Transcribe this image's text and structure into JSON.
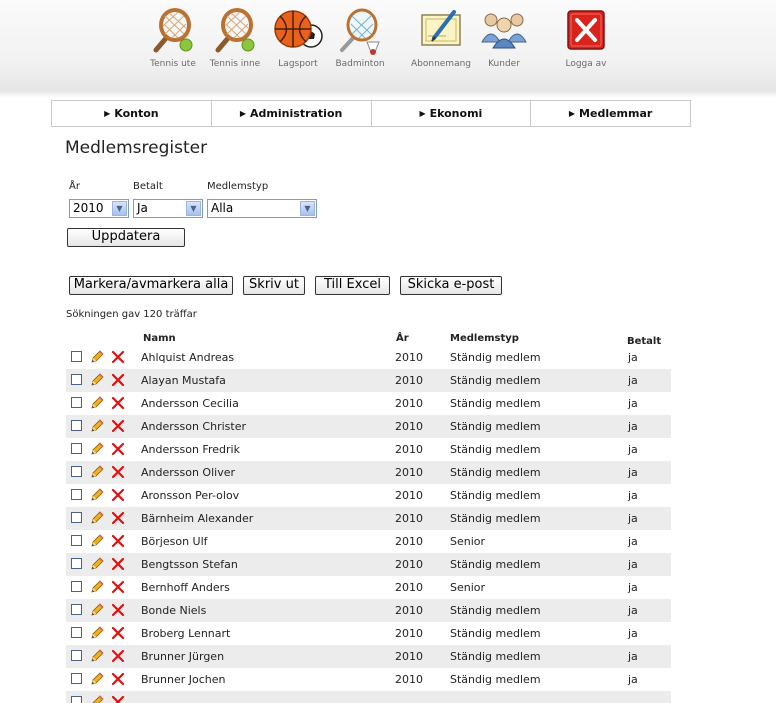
{
  "toolbar": {
    "items": [
      {
        "label": "Tennis ute",
        "icon": "tennis-racket-icon"
      },
      {
        "label": "Tennis inne",
        "icon": "tennis-racket-icon"
      },
      {
        "label": "Lagsport",
        "icon": "team-sports-balls-icon"
      },
      {
        "label": "Badminton",
        "icon": "badminton-icon"
      },
      {
        "label": "Abonnemang",
        "icon": "subscription-icon"
      },
      {
        "label": "Kunder",
        "icon": "customers-icon"
      },
      {
        "label": "Logga av",
        "icon": "logout-icon"
      }
    ]
  },
  "nav": [
    "Konton",
    "Administration",
    "Ekonomi",
    "Medlemmar"
  ],
  "page": {
    "title": "Medlemsregister",
    "filters": {
      "year_label": "År",
      "year_value": "2010",
      "paid_label": "Betalt",
      "paid_value": "Ja",
      "type_label": "Medlemstyp",
      "type_value": "Alla"
    },
    "update_button": "Uppdatera",
    "actions": [
      "Markera/avmarkera alla",
      "Skriv ut",
      "Till Excel",
      "Skicka e-post"
    ],
    "result_text": "Sökningen gav 120 träffar"
  },
  "table": {
    "headers": {
      "name": "Namn",
      "year": "År",
      "type": "Medlemstyp",
      "paid": "Betalt"
    },
    "rows": [
      {
        "name": "Ahlquist Andreas",
        "year": "2010",
        "type": "Ständig medlem",
        "paid": "ja"
      },
      {
        "name": "Alayan Mustafa",
        "year": "2010",
        "type": "Ständig medlem",
        "paid": "ja"
      },
      {
        "name": "Andersson Cecilia",
        "year": "2010",
        "type": "Ständig medlem",
        "paid": "ja"
      },
      {
        "name": "Andersson Christer",
        "year": "2010",
        "type": "Ständig medlem",
        "paid": "ja"
      },
      {
        "name": "Andersson Fredrik",
        "year": "2010",
        "type": "Ständig medlem",
        "paid": "ja"
      },
      {
        "name": "Andersson Oliver",
        "year": "2010",
        "type": "Ständig medlem",
        "paid": "ja"
      },
      {
        "name": "Aronsson Per-olov",
        "year": "2010",
        "type": "Ständig medlem",
        "paid": "ja"
      },
      {
        "name": "Bärnheim Alexander",
        "year": "2010",
        "type": "Ständig medlem",
        "paid": "ja"
      },
      {
        "name": "Börjeson Ulf",
        "year": "2010",
        "type": "Senior",
        "paid": "ja"
      },
      {
        "name": "Bengtsson Stefan",
        "year": "2010",
        "type": "Ständig medlem",
        "paid": "ja"
      },
      {
        "name": "Bernhoff Anders",
        "year": "2010",
        "type": "Senior",
        "paid": "ja"
      },
      {
        "name": "Bonde Niels",
        "year": "2010",
        "type": "Ständig medlem",
        "paid": "ja"
      },
      {
        "name": "Broberg Lennart",
        "year": "2010",
        "type": "Ständig medlem",
        "paid": "ja"
      },
      {
        "name": "Brunner Jürgen",
        "year": "2010",
        "type": "Ständig medlem",
        "paid": "ja"
      },
      {
        "name": "Brunner Jochen",
        "year": "2010",
        "type": "Ständig medlem",
        "paid": "ja"
      },
      {
        "name": "",
        "year": "",
        "type": "",
        "paid": ""
      }
    ]
  }
}
